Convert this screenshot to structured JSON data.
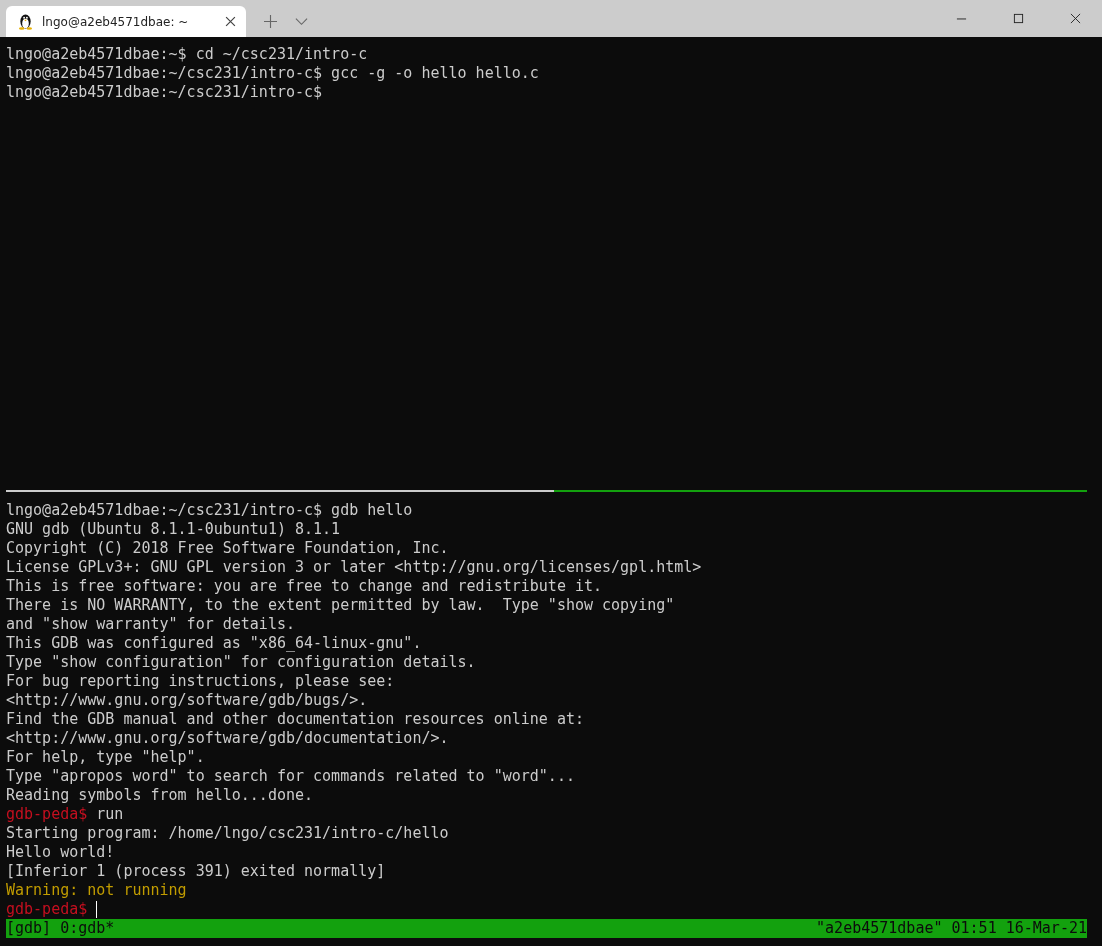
{
  "tabs": [
    {
      "title": "lngo@a2eb4571dbae: ~",
      "selected": true
    }
  ],
  "panes": [
    {
      "lines": [
        {
          "kind": "text",
          "text": "lngo@a2eb4571dbae:~$ cd ~/csc231/intro-c"
        },
        {
          "kind": "text",
          "text": "lngo@a2eb4571dbae:~/csc231/intro-c$ gcc -g -o hello hello.c"
        },
        {
          "kind": "text",
          "text": "lngo@a2eb4571dbae:~/csc231/intro-c$"
        }
      ]
    },
    {
      "lines": [
        {
          "kind": "text",
          "text": "lngo@a2eb4571dbae:~/csc231/intro-c$ gdb hello"
        },
        {
          "kind": "text",
          "text": "GNU gdb (Ubuntu 8.1.1-0ubuntu1) 8.1.1"
        },
        {
          "kind": "text",
          "text": "Copyright (C) 2018 Free Software Foundation, Inc."
        },
        {
          "kind": "text",
          "text": "License GPLv3+: GNU GPL version 3 or later <http://gnu.org/licenses/gpl.html>"
        },
        {
          "kind": "text",
          "text": "This is free software: you are free to change and redistribute it."
        },
        {
          "kind": "text",
          "text": "There is NO WARRANTY, to the extent permitted by law.  Type \"show copying\""
        },
        {
          "kind": "text",
          "text": "and \"show warranty\" for details."
        },
        {
          "kind": "text",
          "text": "This GDB was configured as \"x86_64-linux-gnu\"."
        },
        {
          "kind": "text",
          "text": "Type \"show configuration\" for configuration details."
        },
        {
          "kind": "text",
          "text": "For bug reporting instructions, please see:"
        },
        {
          "kind": "text",
          "text": "<http://www.gnu.org/software/gdb/bugs/>."
        },
        {
          "kind": "text",
          "text": "Find the GDB manual and other documentation resources online at:"
        },
        {
          "kind": "text",
          "text": "<http://www.gnu.org/software/gdb/documentation/>."
        },
        {
          "kind": "text",
          "text": "For help, type \"help\"."
        },
        {
          "kind": "text",
          "text": "Type \"apropos word\" to search for commands related to \"word\"..."
        },
        {
          "kind": "text",
          "text": "Reading symbols from hello...done."
        },
        {
          "kind": "prompt",
          "prompt": "gdb-peda$",
          "text": "run"
        },
        {
          "kind": "text",
          "text": "Starting program: /home/lngo/csc231/intro-c/hello"
        },
        {
          "kind": "text",
          "text": "Hello world!"
        },
        {
          "kind": "text",
          "text": "[Inferior 1 (process 391) exited normally]"
        },
        {
          "kind": "warning",
          "text": "Warning: not running"
        },
        {
          "kind": "prompt",
          "prompt": "gdb-peda$",
          "cursor": true
        }
      ]
    }
  ],
  "status_bar": {
    "left": "[gdb] 0:gdb*",
    "right": "\"a2eb4571dbae\" 01:51 16-Mar-21"
  }
}
